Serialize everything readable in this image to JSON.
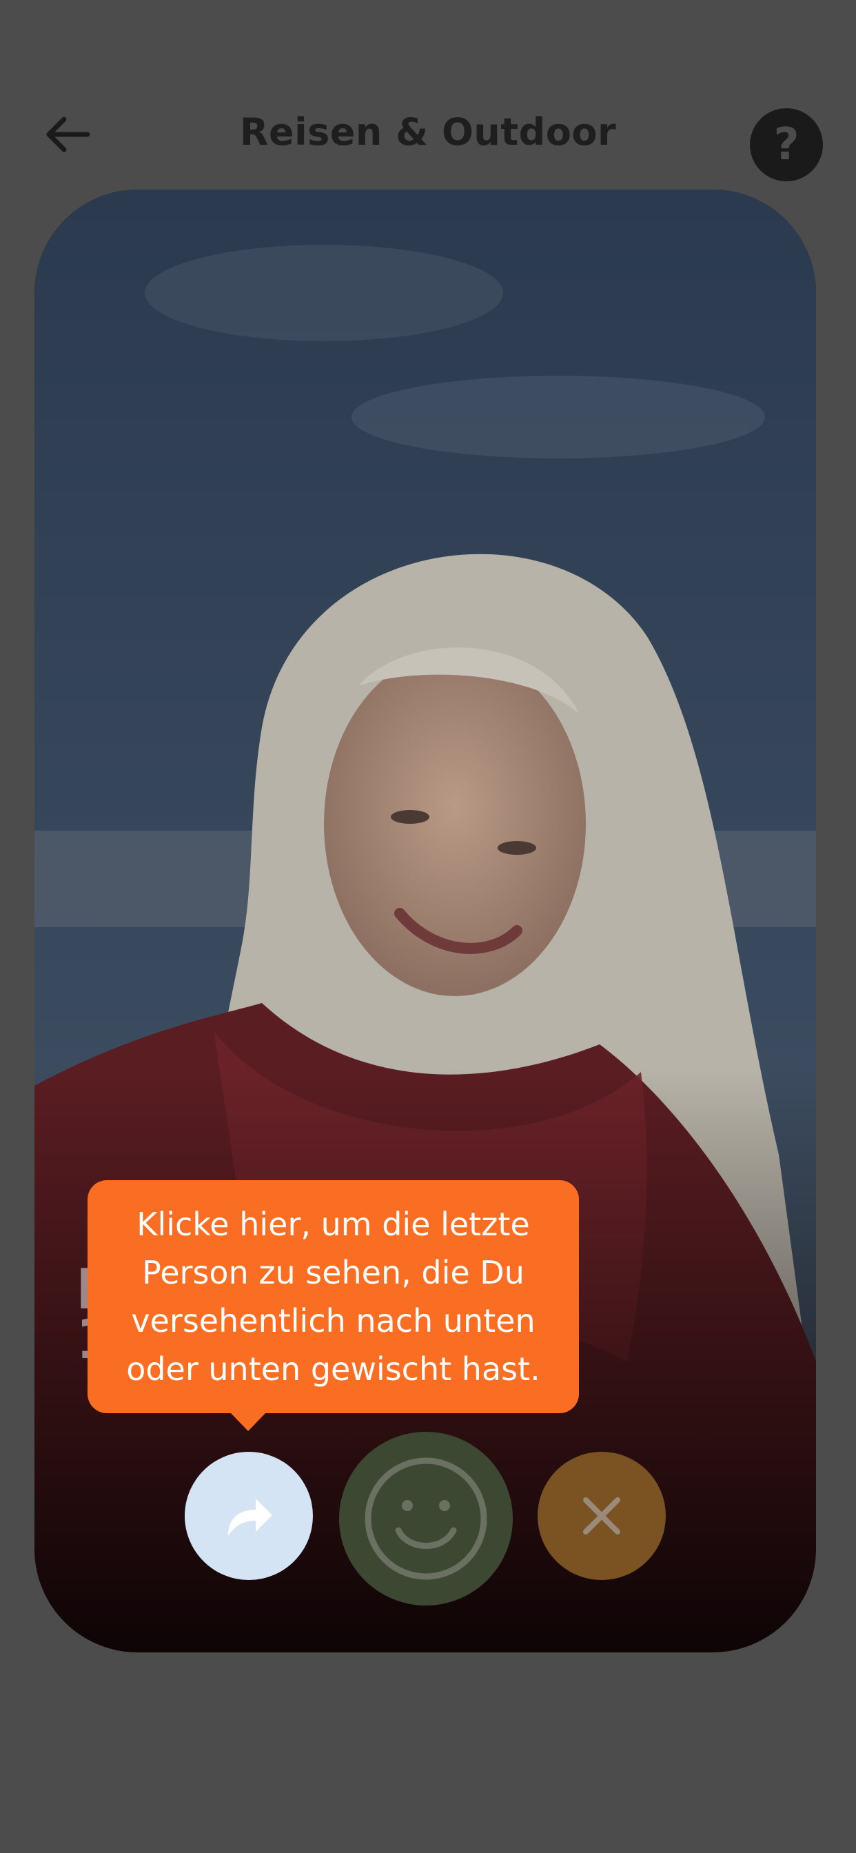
{
  "header": {
    "title": "Reisen & Outdoor",
    "help_label": "?"
  },
  "card": {
    "name_partial": "I",
    "age_partial": "1"
  },
  "tooltip": {
    "text": "Klicke hier, um die letzte Person zu sehen, die Du versehentlich nach unten oder unten gewischt hast."
  },
  "colors": {
    "overlay_bg": "#4c4c4c",
    "tooltip_bg": "#fa6e23",
    "undo_bg": "#d5e4f5",
    "like_bg": "#3d4832",
    "dislike_bg": "#7b5322"
  },
  "icons": {
    "back": "arrow-left-icon",
    "undo": "undo-arrow-icon",
    "like": "smiley-icon",
    "dislike": "close-icon"
  }
}
